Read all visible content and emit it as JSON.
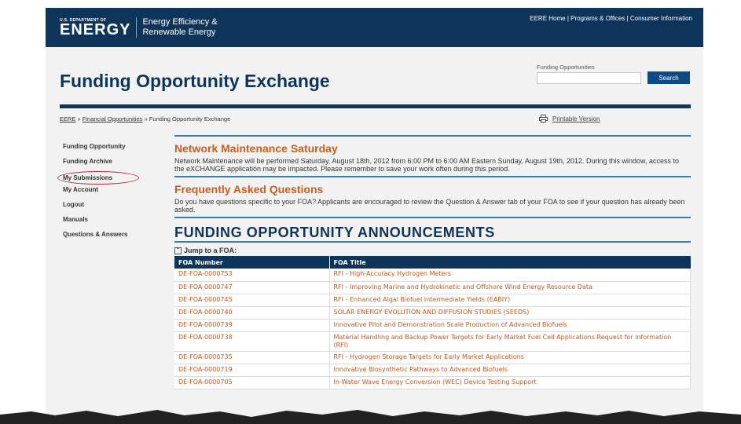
{
  "topbar": {
    "logo_small": "U.S. DEPARTMENT OF",
    "logo_big": "ENERGY",
    "program_line1": "Energy Efficiency &",
    "program_line2": "Renewable Energy",
    "links": "EERE Home | Programs & Offices | Consumer Information"
  },
  "header": {
    "title": "Funding Opportunity Exchange",
    "search_label": "Funding Opportunities",
    "search_value": "",
    "search_button": "Search"
  },
  "breadcrumb": {
    "item1": "EERE",
    "sep": " » ",
    "item2": "Financial Opportunities",
    "item3": "Funding Opportunity Exchange"
  },
  "printable": "Printable Version",
  "sidebar": {
    "items": [
      {
        "label": "Funding Opportunity"
      },
      {
        "label": "Funding Archive"
      },
      {
        "label": "My Submissions"
      },
      {
        "label": "My Account"
      },
      {
        "label": "Logout"
      },
      {
        "label": "Manuals"
      },
      {
        "label": "Questions & Answers"
      }
    ]
  },
  "notice": {
    "title": "Network Maintenance Saturday",
    "text": "Network Maintenance will be performed Saturday, August 18th, 2012 from 6:00 PM to 6:00 AM Eastern Sunday, August 19th, 2012. During this window, access to the eXCHANGE application may be impacted. Please remember to save your work often during this period."
  },
  "faq": {
    "title": "Frequently Asked Questions",
    "text": "Do you have questions specific to your FOA? Applicants are encouraged to review the Question & Answer tab of your FOA to see if your question has already been asked."
  },
  "foa": {
    "title": "FUNDING OPPORTUNITY ANNOUNCEMENTS",
    "jump": "Jump to a FOA:",
    "col_number": "FOA Number",
    "col_title": "FOA Title",
    "rows": [
      {
        "number": "DE-FOA-0000753",
        "title": "RFI - High-Accuracy Hydrogen Meters"
      },
      {
        "number": "DE-FOA-0000747",
        "title": "RFI - Improving Marine and Hydrokinetic and Offshore Wind Energy Resource Data"
      },
      {
        "number": "DE-FOA-0000745",
        "title": "RFI - Enhanced Algal Biofuel Intermediate Yields (EABIY)"
      },
      {
        "number": "DE-FOA-0000740",
        "title": "SOLAR ENERGY EVOLUTION AND DIFFUSION STUDIES (SEEDS)"
      },
      {
        "number": "DE-FOA-0000739",
        "title": "Innovative Pilot and Demonstration Scale Production of Advanced Biofuels"
      },
      {
        "number": "DE-FOA-0000738",
        "title": "Material Handling and Backup Power Targets for Early Market Fuel Cell Applications Request for information (RFI)"
      },
      {
        "number": "DE-FOA-0000735",
        "title": "RFI - Hydrogen Storage Targets for Early Market Applications"
      },
      {
        "number": "DE-FOA-0000719",
        "title": "Innovative Biosynthetic Pathways to Advanced Biofuels"
      },
      {
        "number": "DE-FOA-0000705",
        "title": "In-Water Wave Energy Conversion (WEC) Device Testing Support"
      }
    ]
  },
  "colors": {
    "navy": "#0e3559",
    "orange": "#d05c18",
    "link_orange": "#c9561c",
    "circle_red": "#c0282f"
  }
}
